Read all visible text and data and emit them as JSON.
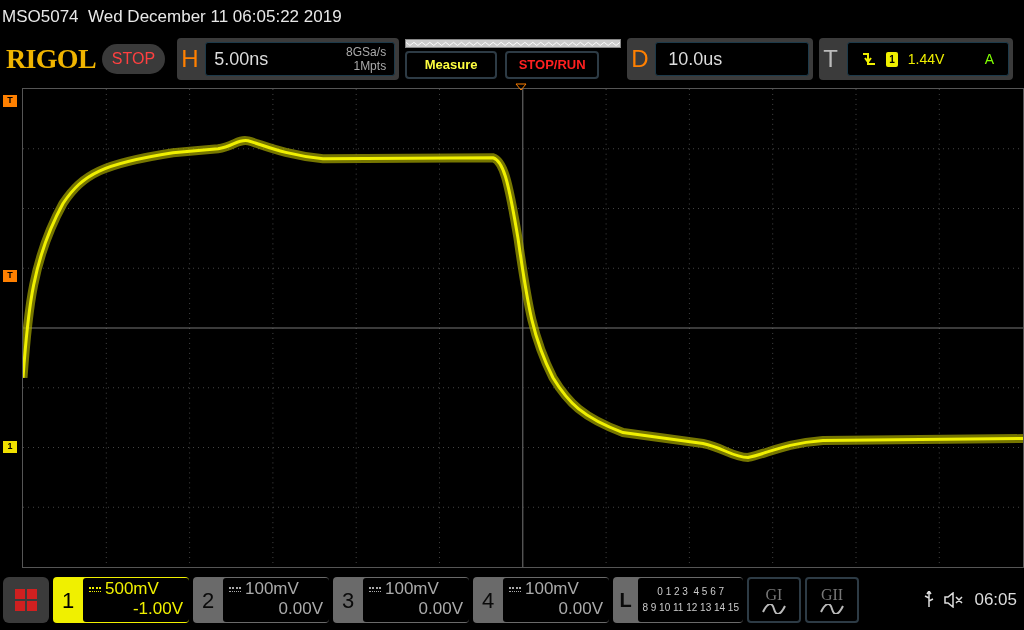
{
  "title": "MSO5074  Wed December 11 06:05:22 2019",
  "logo": "RIGOL",
  "run_state": "STOP",
  "horizontal": {
    "label": "H",
    "timebase": "5.00ns",
    "sample_rate": "8GSa/s",
    "memory": "1Mpts"
  },
  "buttons": [
    "Measure",
    "STOP/RUN"
  ],
  "delay": {
    "label": "D",
    "value": "10.0us"
  },
  "trigger": {
    "label": "T",
    "source": "1",
    "level": "1.44V",
    "mode": "A"
  },
  "markers": [
    {
      "label": "T",
      "color": "#ff8000"
    },
    {
      "label": "T",
      "color": "#ff8000"
    },
    {
      "label": "1",
      "color": "#f0e000"
    }
  ],
  "channels": [
    {
      "number": "1",
      "scale": "500mV",
      "offset": "-1.00V",
      "selected": true
    },
    {
      "number": "2",
      "scale": "100mV",
      "offset": "0.00V",
      "selected": false
    },
    {
      "number": "3",
      "scale": "100mV",
      "offset": "0.00V",
      "selected": false
    },
    {
      "number": "4",
      "scale": "100mV",
      "offset": "0.00V",
      "selected": false
    }
  ],
  "logic": {
    "label": "L",
    "row_1": "0 1 2 3  4 5 6 7",
    "row_2": "8 9 10 11 12 13 14 15"
  },
  "generators": [
    "GI",
    "GII"
  ],
  "status": {
    "time": "06:05"
  }
}
